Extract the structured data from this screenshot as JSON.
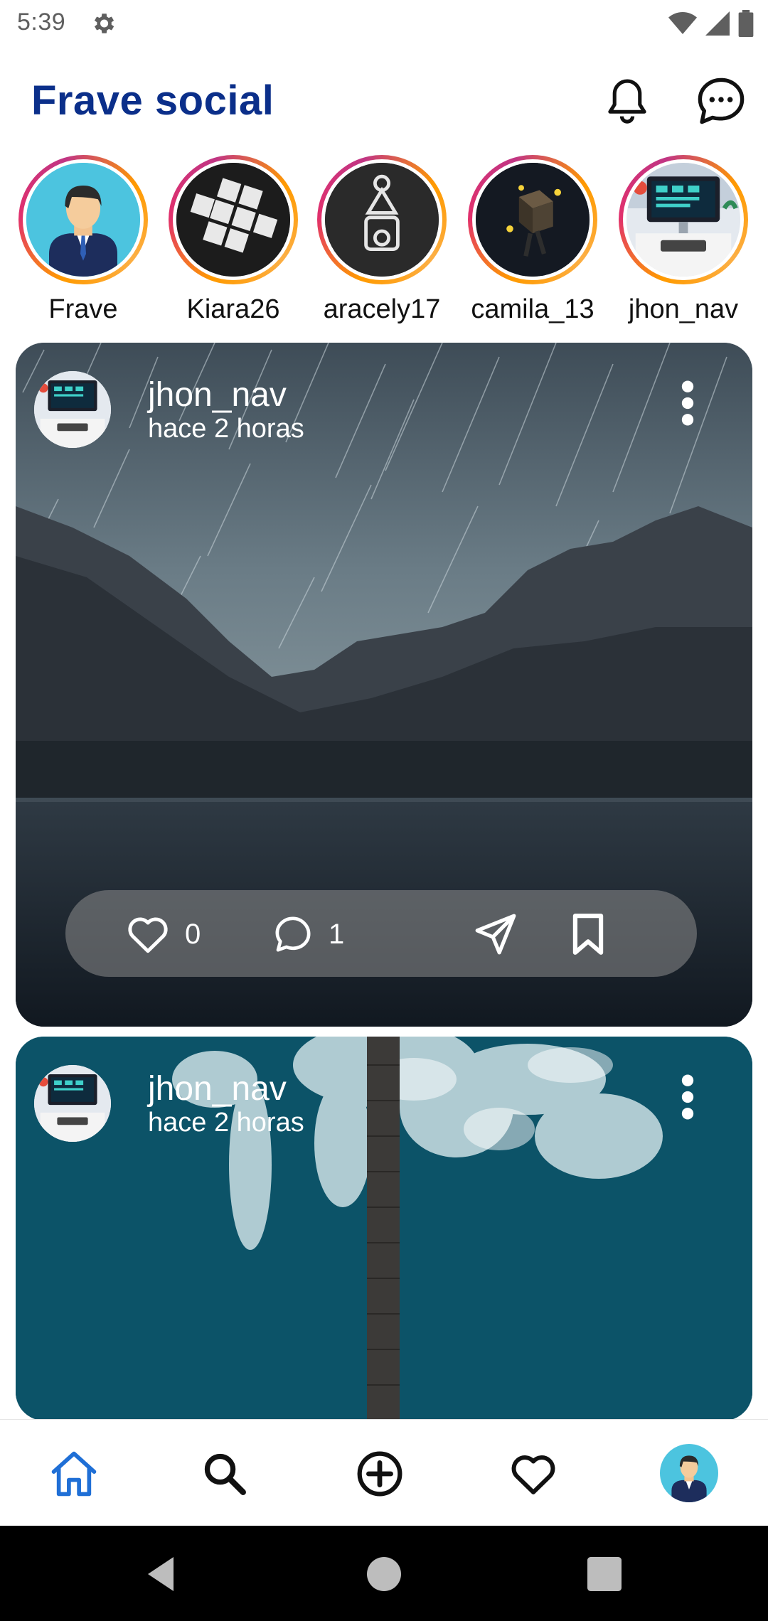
{
  "status_bar": {
    "time": "5:39"
  },
  "header": {
    "title": "Frave social"
  },
  "stories": [
    {
      "name": "Frave"
    },
    {
      "name": "Kiara26"
    },
    {
      "name": "aracely17"
    },
    {
      "name": "camila_13"
    },
    {
      "name": "jhon_nav"
    }
  ],
  "posts": [
    {
      "user": "jhon_nav",
      "time": "hace 2 horas",
      "likes": "0",
      "comments": "1"
    },
    {
      "user": "jhon_nav",
      "time": "hace 2 horas"
    }
  ],
  "icons": {
    "notifications": "bell-icon",
    "messages": "chat-icon",
    "home": "home-icon",
    "search": "search-icon",
    "create": "add-circle-icon",
    "favorites": "heart-icon"
  },
  "colors": {
    "brand": "#0b2f8a",
    "active_nav": "#1f6fd6"
  }
}
